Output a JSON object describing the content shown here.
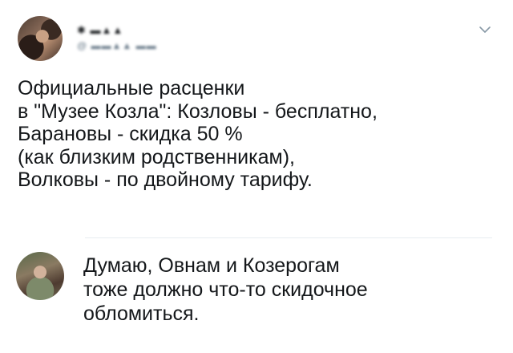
{
  "tweet": {
    "user_name": "✱ ▬▲▲",
    "user_handle": "@ ▬▬▲▲ ▬▬",
    "avatar_icon": "user-avatar-photo",
    "menu_icon": "chevron-down-icon",
    "lines": [
      "Официальные расценки",
      "в \"Музее Козла\": Козловы - бесплатно,",
      "Барановы - скидка 50 %",
      "(как близким родственникам),",
      "Волковы - по двойному тарифу."
    ]
  },
  "reply": {
    "avatar_icon": "user-avatar-photo",
    "lines": [
      "Думаю, Овнам и Козерогам",
      "тоже должно что-то скидочное",
      "обломиться."
    ]
  },
  "colors": {
    "text": "#14171a",
    "secondary": "#657786",
    "divider": "#e6ecf0",
    "background": "#ffffff"
  }
}
